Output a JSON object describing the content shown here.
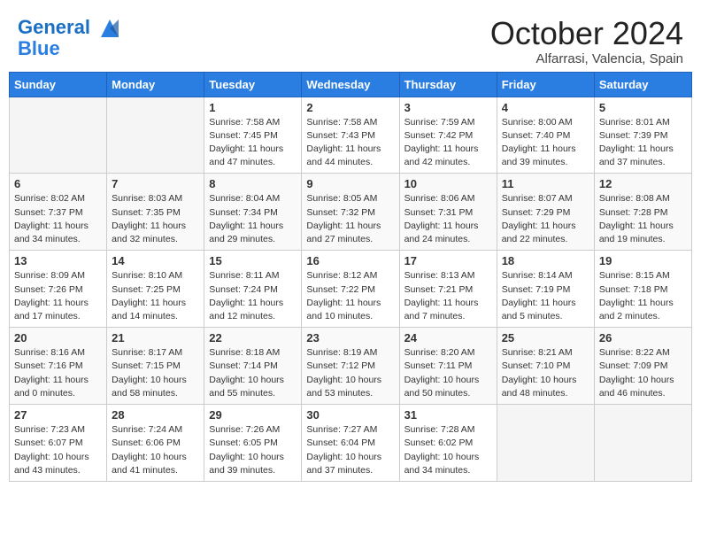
{
  "header": {
    "logo_line1": "General",
    "logo_line2": "Blue",
    "month": "October 2024",
    "location": "Alfarrasi, Valencia, Spain"
  },
  "days_of_week": [
    "Sunday",
    "Monday",
    "Tuesday",
    "Wednesday",
    "Thursday",
    "Friday",
    "Saturday"
  ],
  "weeks": [
    [
      {
        "day": "",
        "info": ""
      },
      {
        "day": "",
        "info": ""
      },
      {
        "day": "1",
        "info": "Sunrise: 7:58 AM\nSunset: 7:45 PM\nDaylight: 11 hours and 47 minutes."
      },
      {
        "day": "2",
        "info": "Sunrise: 7:58 AM\nSunset: 7:43 PM\nDaylight: 11 hours and 44 minutes."
      },
      {
        "day": "3",
        "info": "Sunrise: 7:59 AM\nSunset: 7:42 PM\nDaylight: 11 hours and 42 minutes."
      },
      {
        "day": "4",
        "info": "Sunrise: 8:00 AM\nSunset: 7:40 PM\nDaylight: 11 hours and 39 minutes."
      },
      {
        "day": "5",
        "info": "Sunrise: 8:01 AM\nSunset: 7:39 PM\nDaylight: 11 hours and 37 minutes."
      }
    ],
    [
      {
        "day": "6",
        "info": "Sunrise: 8:02 AM\nSunset: 7:37 PM\nDaylight: 11 hours and 34 minutes."
      },
      {
        "day": "7",
        "info": "Sunrise: 8:03 AM\nSunset: 7:35 PM\nDaylight: 11 hours and 32 minutes."
      },
      {
        "day": "8",
        "info": "Sunrise: 8:04 AM\nSunset: 7:34 PM\nDaylight: 11 hours and 29 minutes."
      },
      {
        "day": "9",
        "info": "Sunrise: 8:05 AM\nSunset: 7:32 PM\nDaylight: 11 hours and 27 minutes."
      },
      {
        "day": "10",
        "info": "Sunrise: 8:06 AM\nSunset: 7:31 PM\nDaylight: 11 hours and 24 minutes."
      },
      {
        "day": "11",
        "info": "Sunrise: 8:07 AM\nSunset: 7:29 PM\nDaylight: 11 hours and 22 minutes."
      },
      {
        "day": "12",
        "info": "Sunrise: 8:08 AM\nSunset: 7:28 PM\nDaylight: 11 hours and 19 minutes."
      }
    ],
    [
      {
        "day": "13",
        "info": "Sunrise: 8:09 AM\nSunset: 7:26 PM\nDaylight: 11 hours and 17 minutes."
      },
      {
        "day": "14",
        "info": "Sunrise: 8:10 AM\nSunset: 7:25 PM\nDaylight: 11 hours and 14 minutes."
      },
      {
        "day": "15",
        "info": "Sunrise: 8:11 AM\nSunset: 7:24 PM\nDaylight: 11 hours and 12 minutes."
      },
      {
        "day": "16",
        "info": "Sunrise: 8:12 AM\nSunset: 7:22 PM\nDaylight: 11 hours and 10 minutes."
      },
      {
        "day": "17",
        "info": "Sunrise: 8:13 AM\nSunset: 7:21 PM\nDaylight: 11 hours and 7 minutes."
      },
      {
        "day": "18",
        "info": "Sunrise: 8:14 AM\nSunset: 7:19 PM\nDaylight: 11 hours and 5 minutes."
      },
      {
        "day": "19",
        "info": "Sunrise: 8:15 AM\nSunset: 7:18 PM\nDaylight: 11 hours and 2 minutes."
      }
    ],
    [
      {
        "day": "20",
        "info": "Sunrise: 8:16 AM\nSunset: 7:16 PM\nDaylight: 11 hours and 0 minutes."
      },
      {
        "day": "21",
        "info": "Sunrise: 8:17 AM\nSunset: 7:15 PM\nDaylight: 10 hours and 58 minutes."
      },
      {
        "day": "22",
        "info": "Sunrise: 8:18 AM\nSunset: 7:14 PM\nDaylight: 10 hours and 55 minutes."
      },
      {
        "day": "23",
        "info": "Sunrise: 8:19 AM\nSunset: 7:12 PM\nDaylight: 10 hours and 53 minutes."
      },
      {
        "day": "24",
        "info": "Sunrise: 8:20 AM\nSunset: 7:11 PM\nDaylight: 10 hours and 50 minutes."
      },
      {
        "day": "25",
        "info": "Sunrise: 8:21 AM\nSunset: 7:10 PM\nDaylight: 10 hours and 48 minutes."
      },
      {
        "day": "26",
        "info": "Sunrise: 8:22 AM\nSunset: 7:09 PM\nDaylight: 10 hours and 46 minutes."
      }
    ],
    [
      {
        "day": "27",
        "info": "Sunrise: 7:23 AM\nSunset: 6:07 PM\nDaylight: 10 hours and 43 minutes."
      },
      {
        "day": "28",
        "info": "Sunrise: 7:24 AM\nSunset: 6:06 PM\nDaylight: 10 hours and 41 minutes."
      },
      {
        "day": "29",
        "info": "Sunrise: 7:26 AM\nSunset: 6:05 PM\nDaylight: 10 hours and 39 minutes."
      },
      {
        "day": "30",
        "info": "Sunrise: 7:27 AM\nSunset: 6:04 PM\nDaylight: 10 hours and 37 minutes."
      },
      {
        "day": "31",
        "info": "Sunrise: 7:28 AM\nSunset: 6:02 PM\nDaylight: 10 hours and 34 minutes."
      },
      {
        "day": "",
        "info": ""
      },
      {
        "day": "",
        "info": ""
      }
    ]
  ]
}
